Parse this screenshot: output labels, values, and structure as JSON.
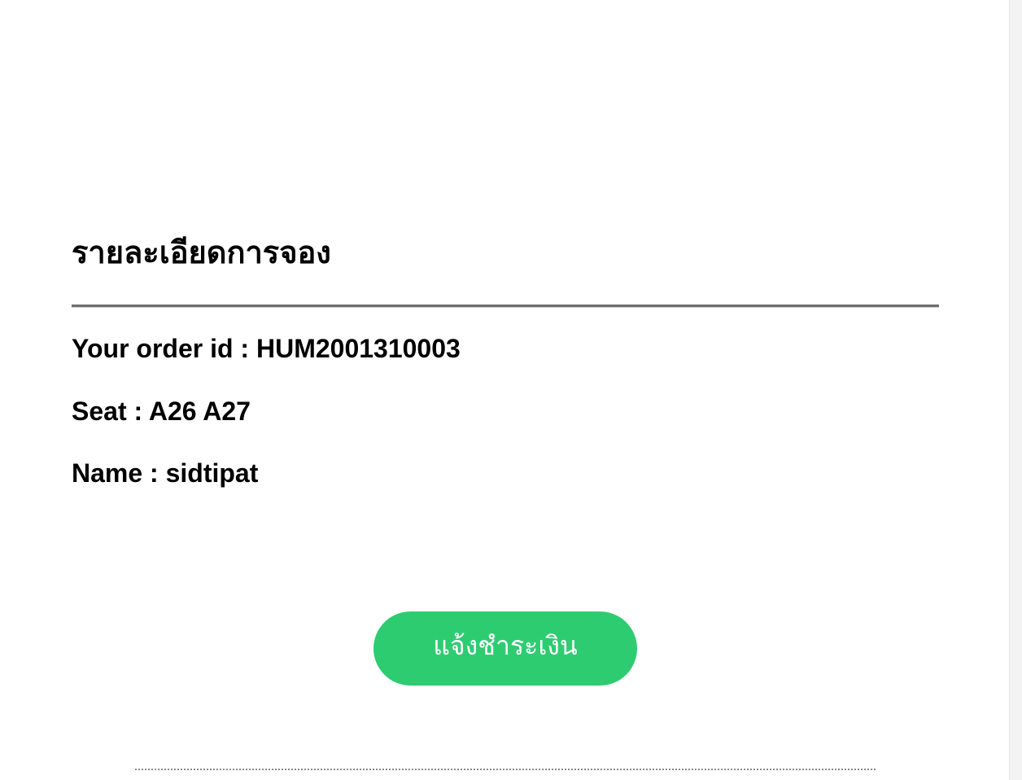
{
  "booking": {
    "title": "รายละเอียดการจอง",
    "order_line": "Your order id : HUM2001310003",
    "seat_line": "Seat : A26 A27",
    "name_line": "Name : sidtipat"
  },
  "actions": {
    "pay_label": "แจ้งชำระเงิน"
  },
  "colors": {
    "button_bg": "#2ecc71",
    "button_text": "#ffffff",
    "text": "#000000"
  }
}
